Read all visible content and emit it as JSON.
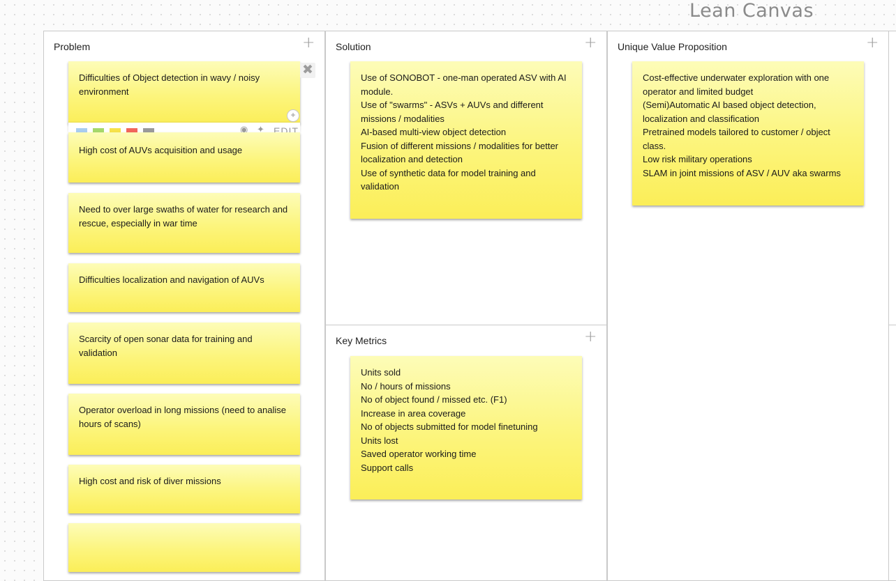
{
  "page_title": "Lean Canvas",
  "panels": {
    "problem": {
      "header": "Problem",
      "notes": [
        [
          "Difficulties of Object detection in wavy / noisy environment"
        ],
        [
          "High cost of AUVs acquisition and usage"
        ],
        [
          "Need to over large swaths of water for research and rescue, especially in war time"
        ],
        [
          "Difficulties localization and navigation of AUVs"
        ],
        [
          "Scarcity of open sonar data for training and validation"
        ],
        [
          "Operator overload in long missions (need to analise hours of scans)"
        ],
        [
          "High cost and risk of diver missions"
        ],
        [
          ""
        ]
      ]
    },
    "solution": {
      "header": "Solution",
      "notes": [
        [
          "Use of SONOBOT - one-man operated ASV with AI module.",
          "Use of \"swarms\" - ASVs + AUVs and different missions / modalities",
          "AI-based multi-view object detection",
          "Fusion of different missions / modalities for better localization and detection",
          "Use of synthetic data for model training and validation"
        ]
      ]
    },
    "key_metrics": {
      "header": "Key Metrics",
      "notes": [
        [
          "Units sold",
          "No / hours of missions",
          "No of object found / missed etc. (F1)",
          "Increase in area coverage",
          "No of objects submitted for model finetuning",
          "Units lost",
          "Saved operator working time",
          "Support calls"
        ]
      ]
    },
    "uvp": {
      "header": "Unique Value Proposition",
      "notes": [
        [
          "Cost-effective underwater exploration with one operator and limited budget",
          "(Semi)Automatic AI based object detection, localization and classification",
          "Pretrained models tailored to customer / object class.",
          "Low risk military operations",
          "SLAM in joint missions of ASV / AUV aka swarms"
        ]
      ]
    }
  },
  "note_toolbar": {
    "colors": [
      "#a8cdf0",
      "#a6d86a",
      "#f7e24a",
      "#f2665a",
      "#9a9a9a"
    ],
    "edit_label": "EDIT"
  },
  "icons": {
    "add": "plus-icon",
    "close": "close-icon",
    "eye": "eye-icon",
    "pin": "pin-icon"
  }
}
